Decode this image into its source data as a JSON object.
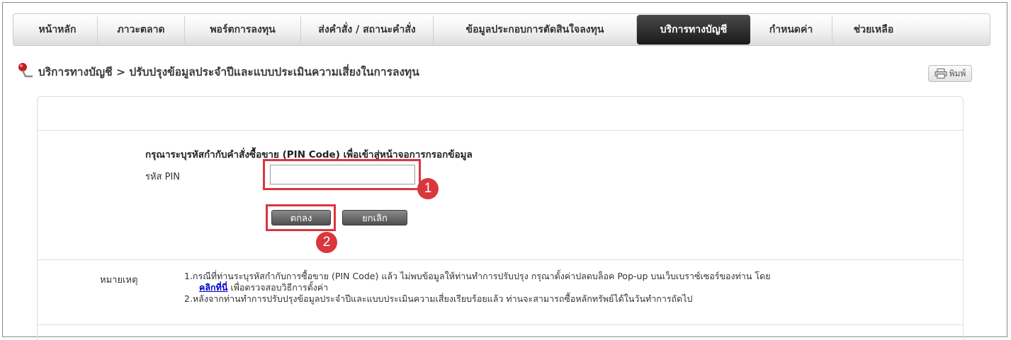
{
  "nav": {
    "items": [
      {
        "label": "หน้าหลัก",
        "active": false
      },
      {
        "label": "ภาวะตลาด",
        "active": false
      },
      {
        "label": "พอร์ตการลงทุน",
        "active": false
      },
      {
        "label": "ส่งคำสั่ง / สถานะคำสั่ง",
        "active": false
      },
      {
        "label": "ข้อมูลประกอบการตัดสินใจลงทุน",
        "active": false
      },
      {
        "label": "บริการทางบัญชี",
        "active": true
      },
      {
        "label": "กำหนดค่า",
        "active": false
      },
      {
        "label": "ช่วยเหลือ",
        "active": false
      }
    ]
  },
  "breadcrumb": "บริการทางบัญชี > ปรับปรุงข้อมูลประจำปีและแบบประเมินความเสี่ยงในการลงทุน",
  "print_label": "พิมพ์",
  "form": {
    "instruction": "กรุณาระบุรหัสกำกับคำสั่งซื้อขาย (PIN Code) เพื่อเข้าสู่หน้าจอการกรอกข้อมูล",
    "pin_label": "รหัส PIN",
    "pin_value": "",
    "ok_label": "ตกลง",
    "cancel_label": "ยกเลิก"
  },
  "annotations": {
    "step1": "1",
    "step2": "2",
    "color": "#d9363e"
  },
  "notes": {
    "label": "หมายเหตุ",
    "line1": "1.กรณีที่ท่านระบุรหัสกำกับการซื้อขาย (PIN Code) แล้ว ไม่พบข้อมูลให้ท่านทำการปรับปรุง กรุณาตั้งค่าปลดบล็อค Pop-up บนเว็บเบราซ์เซอร์ของท่าน โดย",
    "link": "คลิกที่นี่",
    "line1b": " เพื่อตรวจสอบวิธีการตั้งค่า",
    "line2": "2.หลังจากท่านทำการปรับปรุงข้อมูลประจำปีและแบบประเมินความเสี่ยงเรียบร้อยแล้ว ท่านจะสามารถซื้อหลักทรัพย์ได้ในวันทำการถัดไป"
  },
  "icons": {
    "breadcrumb": "pin-icon",
    "print": "printer-icon"
  }
}
